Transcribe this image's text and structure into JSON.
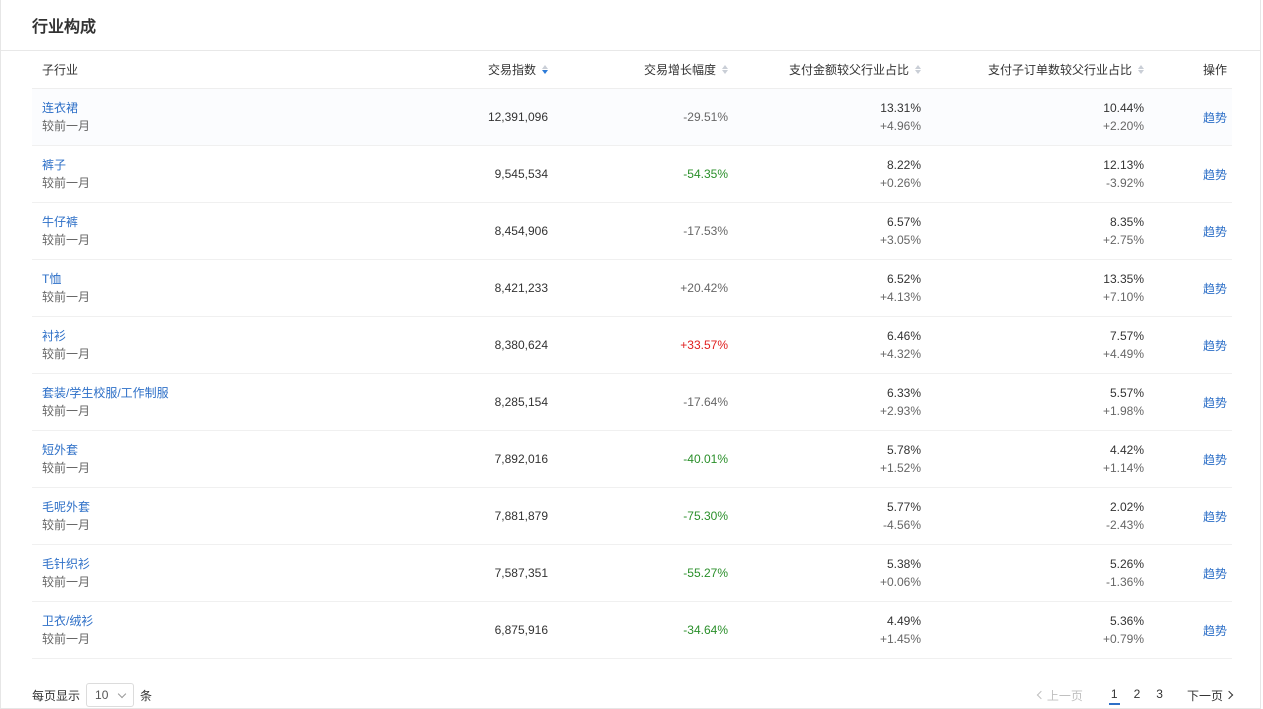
{
  "panel": {
    "title": "行业构成"
  },
  "columns": {
    "name": "子行业",
    "index": "交易指数",
    "growth": "交易增长幅度",
    "pay": "支付金额较父行业占比",
    "suborder": "支付子订单数较父行业占比",
    "op": "操作"
  },
  "compare_label": "较前一月",
  "op_label": "趋势",
  "rows": [
    {
      "name": "连衣裙",
      "index": "12,391,096",
      "growth": "-29.51%",
      "growth_color": "neutral",
      "pay": "13.31%",
      "pay_delta": "+4.96%",
      "sub": "10.44%",
      "sub_delta": "+2.20%"
    },
    {
      "name": "裤子",
      "index": "9,545,534",
      "growth": "-54.35%",
      "growth_color": "green",
      "pay": "8.22%",
      "pay_delta": "+0.26%",
      "sub": "12.13%",
      "sub_delta": "-3.92%"
    },
    {
      "name": "牛仔裤",
      "index": "8,454,906",
      "growth": "-17.53%",
      "growth_color": "neutral",
      "pay": "6.57%",
      "pay_delta": "+3.05%",
      "sub": "8.35%",
      "sub_delta": "+2.75%"
    },
    {
      "name": "T恤",
      "index": "8,421,233",
      "growth": "+20.42%",
      "growth_color": "neutral",
      "pay": "6.52%",
      "pay_delta": "+4.13%",
      "sub": "13.35%",
      "sub_delta": "+7.10%"
    },
    {
      "name": "衬衫",
      "index": "8,380,624",
      "growth": "+33.57%",
      "growth_color": "red",
      "pay": "6.46%",
      "pay_delta": "+4.32%",
      "sub": "7.57%",
      "sub_delta": "+4.49%"
    },
    {
      "name": "套装/学生校服/工作制服",
      "index": "8,285,154",
      "growth": "-17.64%",
      "growth_color": "neutral",
      "pay": "6.33%",
      "pay_delta": "+2.93%",
      "sub": "5.57%",
      "sub_delta": "+1.98%"
    },
    {
      "name": "短外套",
      "index": "7,892,016",
      "growth": "-40.01%",
      "growth_color": "green",
      "pay": "5.78%",
      "pay_delta": "+1.52%",
      "sub": "4.42%",
      "sub_delta": "+1.14%"
    },
    {
      "name": "毛呢外套",
      "index": "7,881,879",
      "growth": "-75.30%",
      "growth_color": "green",
      "pay": "5.77%",
      "pay_delta": "-4.56%",
      "sub": "2.02%",
      "sub_delta": "-2.43%"
    },
    {
      "name": "毛针织衫",
      "index": "7,587,351",
      "growth": "-55.27%",
      "growth_color": "green",
      "pay": "5.38%",
      "pay_delta": "+0.06%",
      "sub": "5.26%",
      "sub_delta": "-1.36%"
    },
    {
      "name": "卫衣/绒衫",
      "index": "6,875,916",
      "growth": "-34.64%",
      "growth_color": "green",
      "pay": "4.49%",
      "pay_delta": "+1.45%",
      "sub": "5.36%",
      "sub_delta": "+0.79%"
    }
  ],
  "colors": {
    "link": "#2d6fc7",
    "green": "#2a8f2a",
    "red": "#e02020",
    "neutral": "#666666"
  },
  "footer": {
    "page_size_label": "每页显示",
    "page_size_value": "10",
    "page_size_unit": "条",
    "prev_label": "上一页",
    "next_label": "下一页",
    "pages": [
      "1",
      "2",
      "3"
    ],
    "current_page": "1"
  },
  "icons": {
    "sort_index": "sort-desc-icon",
    "sort_other": "sort-icon",
    "select_chevron": "chevron-down-icon",
    "prev": "chevron-left-icon",
    "next": "chevron-right-icon"
  }
}
